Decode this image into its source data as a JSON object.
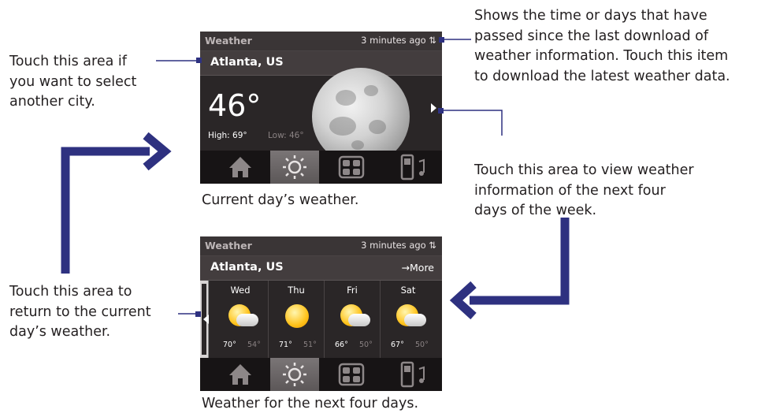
{
  "annotations": {
    "sync_note": [
      "Shows the time or days that have",
      "passed since the last download of",
      "weather information. Touch this item",
      "to download the latest weather data."
    ],
    "city_note": [
      "Touch this area if",
      "you want to select",
      "another city."
    ],
    "next_days_note": [
      "Touch this area to view weather",
      "information of the next four",
      "days of the week."
    ],
    "return_note": [
      "Touch this area to",
      "return to the current",
      "day’s weather."
    ]
  },
  "captions": {
    "current": "Current day’s weather.",
    "next": "Weather for the next four days."
  },
  "screen_current": {
    "title": "Weather",
    "updated": "3 minutes ago",
    "city": "Atlanta, US",
    "temperature": "46°",
    "high": "High: 69°",
    "low": "Low: 46°"
  },
  "screen_forecast": {
    "title": "Weather",
    "updated": "3 minutes ago",
    "city": "Atlanta, US",
    "more": "→More",
    "days": [
      {
        "day": "Wed",
        "high": "70°",
        "low": "54°",
        "icon": "partly-cloudy-icon"
      },
      {
        "day": "Thu",
        "high": "71°",
        "low": "51°",
        "icon": "sunny-icon"
      },
      {
        "day": "Fri",
        "high": "66°",
        "low": "50°",
        "icon": "partly-cloudy-icon"
      },
      {
        "day": "Sat",
        "high": "67°",
        "low": "50°",
        "icon": "partly-cloudy-icon"
      }
    ]
  },
  "tabs": [
    "home-tab",
    "weather-tab",
    "apps-tab",
    "music-tab"
  ],
  "colors": {
    "callout_line": "#2e3180",
    "arrow": "#2e3180",
    "screen_bg": "#2a2627",
    "text": "#231f20"
  }
}
